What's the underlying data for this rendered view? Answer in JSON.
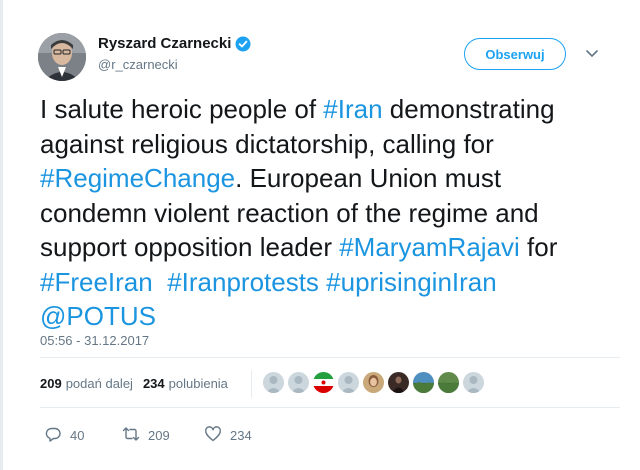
{
  "author": {
    "name": "Ryszard Czarnecki",
    "handle": "@r_czarnecki",
    "follow_label": "Obserwuj"
  },
  "tweet": {
    "lines": [
      [
        {
          "t": "I salute heroic people of "
        },
        {
          "t": "#Iran",
          "link": true
        },
        {
          "t": " demonstrating"
        }
      ],
      [
        {
          "t": "against religious dictatorship, calling for"
        }
      ],
      [
        {
          "t": "#RegimeChange",
          "link": true
        },
        {
          "t": ". European Union must"
        }
      ],
      [
        {
          "t": "condemn violent reaction of the regime and"
        }
      ],
      [
        {
          "t": "support opposition leader "
        },
        {
          "t": "#MaryamRajavi",
          "link": true
        },
        {
          "t": " for"
        }
      ],
      [
        {
          "t": "#FreeIran",
          "link": true
        },
        {
          "t": "  "
        },
        {
          "t": "#Iranprotests",
          "link": true
        },
        {
          "t": " "
        },
        {
          "t": "#uprisinginIran",
          "link": true
        }
      ],
      [
        {
          "t": "@POTUS",
          "link": true
        }
      ]
    ],
    "timestamp": "05:56 - 31.12.2017"
  },
  "stats": {
    "retweets_count": "209",
    "retweets_label": "podań dalej",
    "likes_count": "234",
    "likes_label": "polubienia"
  },
  "liker_avatars": [
    {
      "name": "default-avatar",
      "color": "#ccd6dd"
    },
    {
      "name": "default-avatar",
      "color": "#ccd6dd"
    },
    {
      "name": "iran-flag-avatar",
      "color": "#239f40"
    },
    {
      "name": "default-avatar",
      "color": "#ccd6dd"
    },
    {
      "name": "portrait-avatar",
      "color": "#8a5a3c"
    },
    {
      "name": "dark-photo-avatar",
      "color": "#3a2a26"
    },
    {
      "name": "landscape-avatar",
      "color": "#4f8fbf"
    },
    {
      "name": "landscape-avatar",
      "color": "#5f8a4a"
    },
    {
      "name": "default-avatar",
      "color": "#ccd6dd"
    }
  ],
  "actions": {
    "reply_count": "40",
    "retweet_count": "209",
    "like_count": "234"
  },
  "colors": {
    "link": "#1b95e0",
    "follow": "#1da1f2",
    "muted": "#657786",
    "text": "#14171a",
    "verified": "#1da1f2"
  },
  "icons": [
    "verified-badge-icon",
    "chevron-down-icon",
    "reply-icon",
    "retweet-icon",
    "heart-icon"
  ]
}
